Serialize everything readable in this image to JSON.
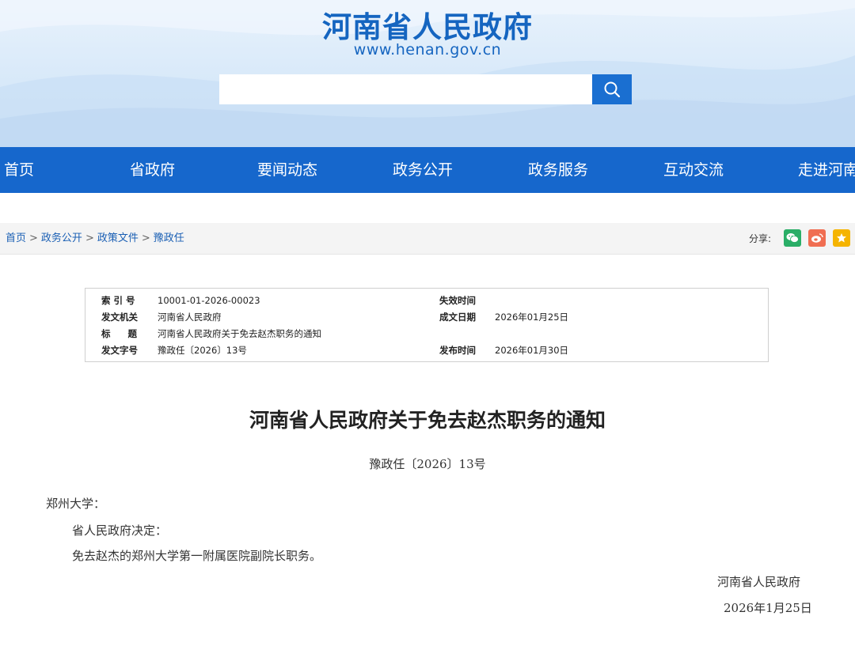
{
  "header": {
    "site_title": "河南省人民政府",
    "site_url": "www.henan.gov.cn",
    "search_placeholder": "",
    "brand_color": "#1565c0"
  },
  "nav": {
    "color": "#1667cc",
    "items": [
      "首页",
      "省政府",
      "要闻动态",
      "政务公开",
      "政务服务",
      "互动交流",
      "走进河南"
    ]
  },
  "breadcrumb": {
    "items": [
      "首页",
      "政务公开",
      "政策文件",
      "豫政任"
    ],
    "separator": ">"
  },
  "share": {
    "label": "分享:",
    "buttons": [
      {
        "name": "wechat-icon",
        "color": "#2aae67"
      },
      {
        "name": "weibo-icon",
        "color": "#f06e52"
      },
      {
        "name": "star-icon",
        "color": "#f5b400"
      }
    ]
  },
  "info": {
    "index_label": "索 引 号",
    "index_value": "10001-01-2026-00023",
    "invalid_label": "失效时间",
    "invalid_value": "",
    "issuer_label": "发文机关",
    "issuer_value": "河南省人民政府",
    "created_label": "成文日期",
    "created_value": "2026年01月25日",
    "title_label": "标 题",
    "title_value": "河南省人民政府关于免去赵杰职务的通知",
    "docno_label": "发文字号",
    "docno_value": "豫政任〔2026〕13号",
    "published_label": "发布时间",
    "published_value": "2026年01月30日"
  },
  "document": {
    "title": "河南省人民政府关于免去赵杰职务的通知",
    "number": "豫政任〔2026〕13号",
    "addressee": "郑州大学：",
    "paragraphs": [
      "省人民政府决定：",
      "免去赵杰的郑州大学第一附属医院副院长职务。"
    ],
    "signature": "河南省人民政府",
    "date": "2026年1月25日"
  }
}
